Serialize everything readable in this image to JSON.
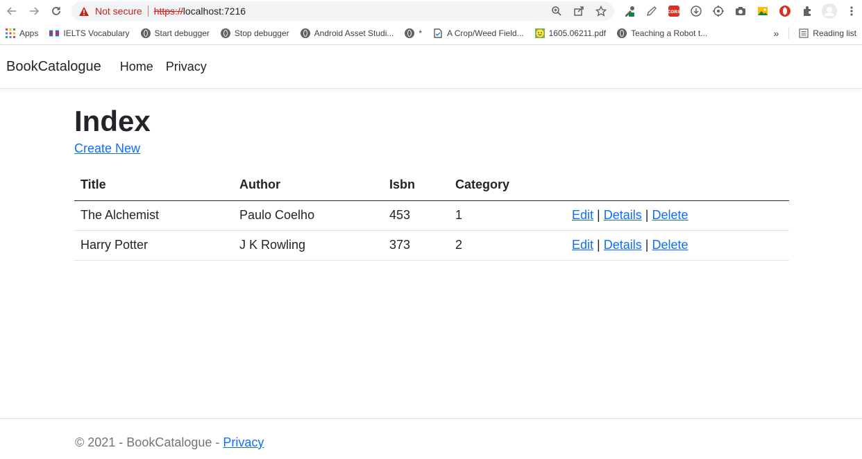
{
  "browser": {
    "security_label": "Not secure",
    "url_scheme": "https://",
    "url_host": "localhost:7216",
    "bookmarks": [
      {
        "label": "Apps",
        "icon": "apps-grid-icon"
      },
      {
        "label": "IELTS Vocabulary",
        "icon": "ielts-icon"
      },
      {
        "label": "Start debugger",
        "icon": "globe-icon"
      },
      {
        "label": "Stop debugger",
        "icon": "globe-icon"
      },
      {
        "label": "Android Asset Studi...",
        "icon": "globe-icon"
      },
      {
        "label": "*",
        "icon": "globe-icon"
      },
      {
        "label": "A Crop/Weed Field...",
        "icon": "doc-icon"
      },
      {
        "label": "1605.06211.pdf",
        "icon": "smiley-icon"
      },
      {
        "label": "Teaching a Robot t...",
        "icon": "globe-icon"
      }
    ],
    "more_bookmarks": "»",
    "reading_list": "Reading list"
  },
  "site": {
    "brand": "BookCatalogue",
    "nav": [
      "Home",
      "Privacy"
    ],
    "page_title": "Index",
    "create_new": "Create New",
    "columns": [
      "Title",
      "Author",
      "Isbn",
      "Category"
    ],
    "rows": [
      {
        "title": "The Alchemist",
        "author": "Paulo Coelho",
        "isbn": "453",
        "category": "1"
      },
      {
        "title": "Harry Potter",
        "author": "J K Rowling",
        "isbn": "373",
        "category": "2"
      }
    ],
    "actions": {
      "edit": "Edit",
      "details": "Details",
      "delete": "Delete",
      "separator": "|"
    },
    "footer": {
      "text": "© 2021 - BookCatalogue - ",
      "link": "Privacy"
    }
  },
  "colors": {
    "link": "#0d6efd",
    "warning": "#c5221f",
    "text": "#212529",
    "muted": "#6c757d"
  }
}
